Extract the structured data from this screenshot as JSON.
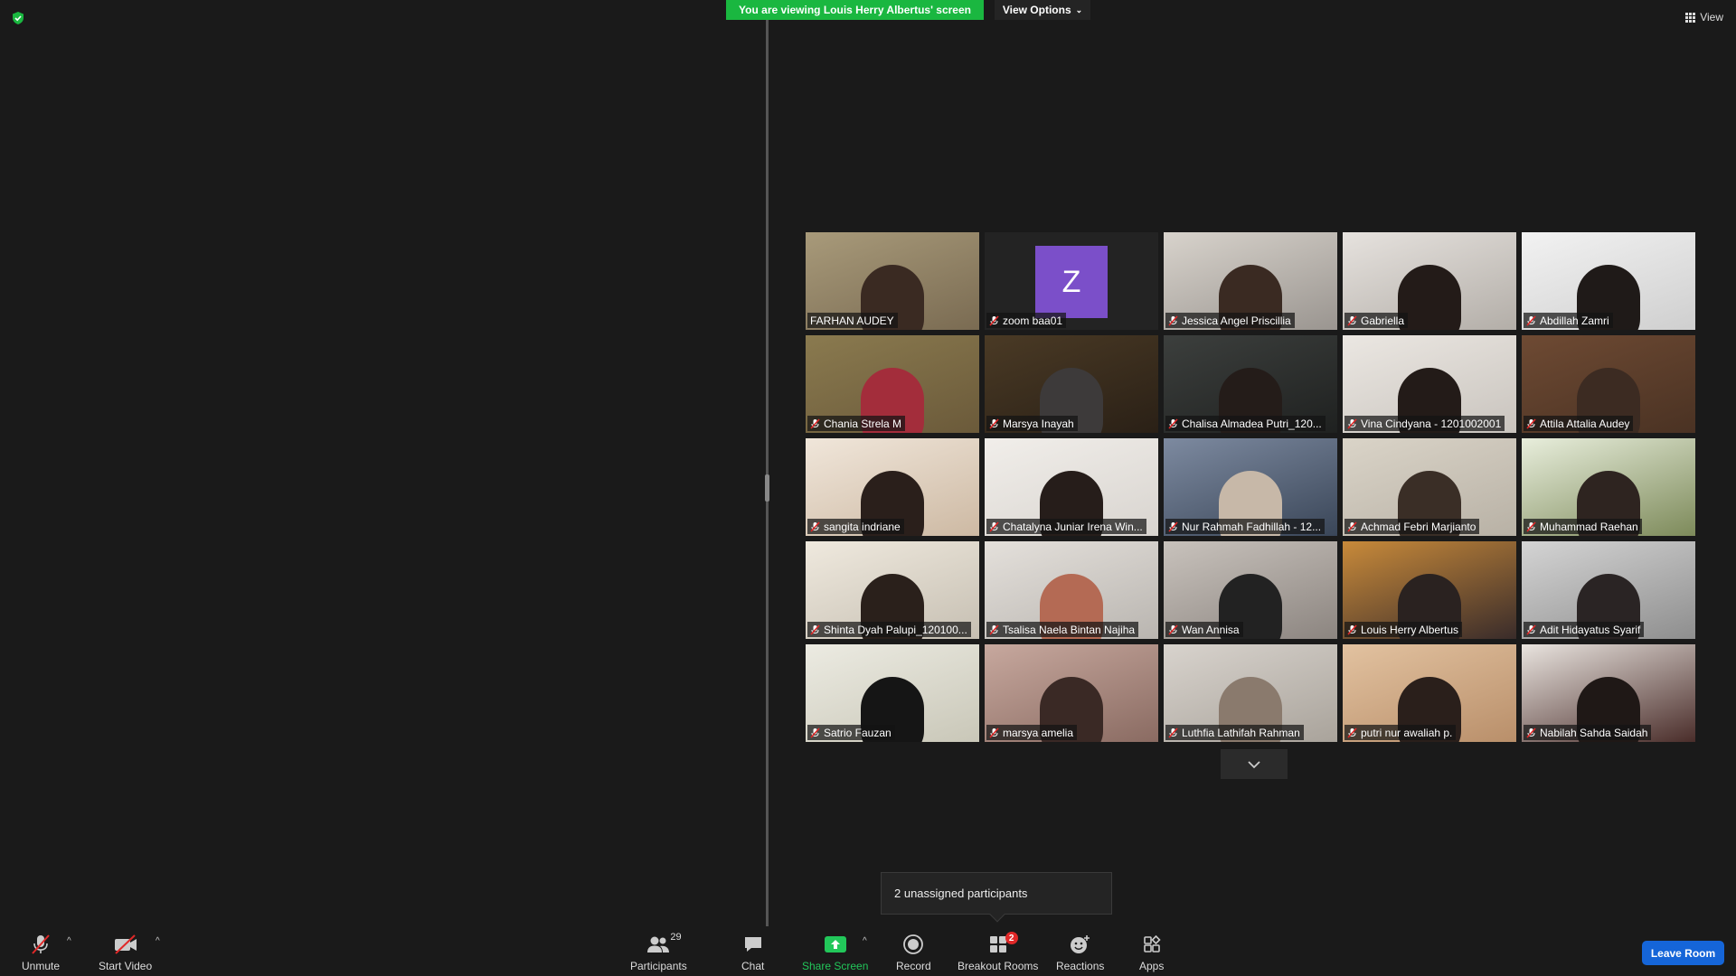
{
  "banner": {
    "text": "You are viewing Louis Herry Albertus' screen"
  },
  "view_options": {
    "label": "View Options",
    "chevron": "⌄"
  },
  "view_menu": {
    "label": "View"
  },
  "tiles": [
    {
      "name": "FARHAN AUDEY",
      "muted": false,
      "active": true,
      "bg": "#7a6b52",
      "bg2": "#a89a7a",
      "skin": "#3a2a22"
    },
    {
      "name": "zoom baa01",
      "muted": true,
      "avatar": "Z",
      "bg": "#232323",
      "bg2": "#232323"
    },
    {
      "name": "Jessica Angel Priscillia",
      "muted": true,
      "bg": "#9a9590",
      "bg2": "#d8d3cc",
      "skin": "#3a2a22"
    },
    {
      "name": "Gabriella",
      "muted": true,
      "bg": "#b3aea8",
      "bg2": "#e6e2de",
      "skin": "#231b18"
    },
    {
      "name": "Abdillah Zamri",
      "muted": true,
      "bg": "#cfcfcf",
      "bg2": "#f2f2f2",
      "skin": "#1f1a18"
    },
    {
      "name": "Chania Strela M",
      "muted": true,
      "bg": "#6b5a3a",
      "bg2": "#8a7a4f",
      "skin": "#a32d3b"
    },
    {
      "name": "Marsya Inayah",
      "muted": true,
      "bg": "#2a2016",
      "bg2": "#4a3a25",
      "skin": "#3d3a3a"
    },
    {
      "name": "Chalisa Almadea Putri_120...",
      "muted": true,
      "bg": "#1f2120",
      "bg2": "#3c3f3d",
      "skin": "#241c19"
    },
    {
      "name": "Vina Cindyana - 1201002001",
      "muted": true,
      "bg": "#c9c4be",
      "bg2": "#ebe7e2",
      "skin": "#231b18"
    },
    {
      "name": "Attila Attalia Audey",
      "muted": true,
      "bg": "#4a3223",
      "bg2": "#6e4a33",
      "skin": "#3c2b22"
    },
    {
      "name": "sangita indriane",
      "muted": true,
      "bg": "#cdb9a3",
      "bg2": "#f0e6da",
      "skin": "#2a1f1b"
    },
    {
      "name": "Chatalyna Juniar Irena Win...",
      "muted": true,
      "bg": "#d8d4cf",
      "bg2": "#f1eeea",
      "skin": "#261d1a"
    },
    {
      "name": "Nur Rahmah Fadhillah - 12...",
      "muted": true,
      "bg": "#3a4658",
      "bg2": "#7d8aa0",
      "skin": "#c7b8a8"
    },
    {
      "name": "Achmad Febri Marjianto",
      "muted": true,
      "bg": "#b8b1a5",
      "bg2": "#dad4c8",
      "skin": "#3a2e26"
    },
    {
      "name": "Muhammad Raehan",
      "muted": true,
      "bg": "#7d8a5a",
      "bg2": "#e8eedc",
      "skin": "#2e2420"
    },
    {
      "name": "Shinta Dyah Palupi_120100...",
      "muted": true,
      "bg": "#c6bfb2",
      "bg2": "#efe9de",
      "skin": "#2a201b"
    },
    {
      "name": "Tsalisa Naela Bintan Najiha",
      "muted": true,
      "bg": "#b9b5b0",
      "bg2": "#e4e0db",
      "skin": "#b46a54"
    },
    {
      "name": "Wan Annisa",
      "muted": true,
      "bg": "#8c8580",
      "bg2": "#c8c2bc",
      "skin": "#222222"
    },
    {
      "name": "Louis Herry Albertus",
      "muted": true,
      "bg": "#3a2c2a",
      "bg2": "#c88a3a",
      "skin": "#2a2220"
    },
    {
      "name": "Adit Hidayatus Syarif",
      "muted": true,
      "bg": "#8e8e8e",
      "bg2": "#d4d4d4",
      "skin": "#2a2424"
    },
    {
      "name": "Satrio Fauzan",
      "muted": true,
      "bg": "#c9c7b8",
      "bg2": "#ecebe2",
      "skin": "#151515"
    },
    {
      "name": "marsya amelia",
      "muted": true,
      "bg": "#8a6b62",
      "bg2": "#c7a89e",
      "skin": "#3a2925"
    },
    {
      "name": "Luthfia Lathifah Rahman",
      "muted": true,
      "bg": "#a9a39b",
      "bg2": "#d8d3cd",
      "skin": "#8a7a6d"
    },
    {
      "name": "putri nur awaliah p.",
      "muted": true,
      "bg": "#b98f6a",
      "bg2": "#e2c2a0",
      "skin": "#2a1f1b"
    },
    {
      "name": "Nabilah Sahda Saidah",
      "muted": true,
      "bg": "#4a2d2a",
      "bg2": "#e9e4df",
      "skin": "#1f1816"
    }
  ],
  "toast": {
    "text": "2 unassigned participants"
  },
  "toolbar": {
    "unmute": "Unmute",
    "start_video": "Start Video",
    "participants": "Participants",
    "participants_count": "29",
    "chat": "Chat",
    "share_screen": "Share Screen",
    "record": "Record",
    "breakout_rooms": "Breakout Rooms",
    "breakout_badge": "2",
    "reactions": "Reactions",
    "apps": "Apps",
    "leave_room": "Leave Room",
    "caret": "^"
  },
  "colors": {
    "banner_green": "#1ab740",
    "share_green": "#22c75a",
    "leave_blue": "#1565d8",
    "active_border": "#c9e84a",
    "avatar_purple": "#7b4fc9",
    "badge_red": "#e02828"
  }
}
